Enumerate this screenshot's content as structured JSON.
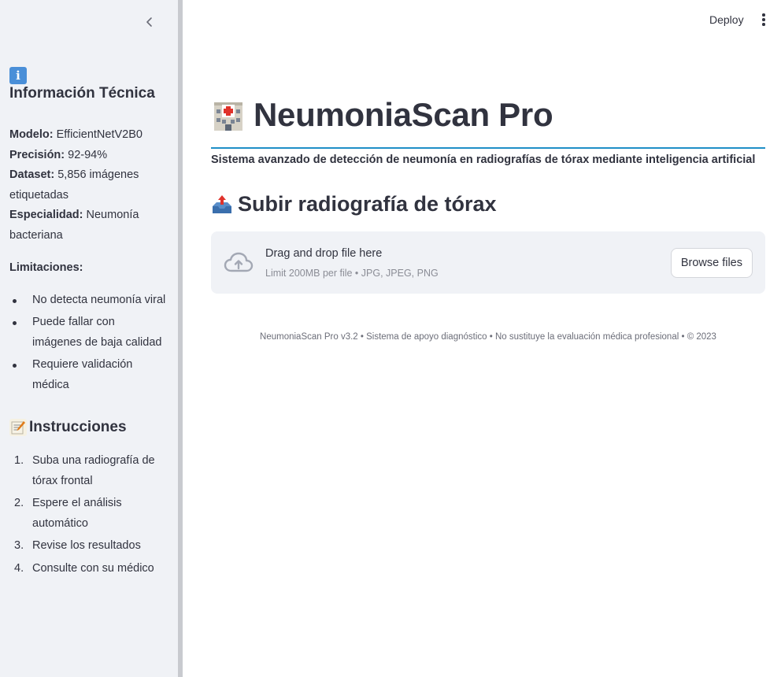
{
  "sidebar": {
    "collapse_icon": "chevron-left-icon",
    "info_heading": "Información Técnica",
    "info_icon": "info-icon",
    "specs": [
      {
        "label": "Modelo:",
        "value": " EfficientNetV2B0"
      },
      {
        "label": "Precisión:",
        "value": " 92-94%"
      },
      {
        "label": "Dataset:",
        "value": " 5,856 imágenes etiquetadas"
      },
      {
        "label": "Especialidad:",
        "value": " Neumonía bacteriana"
      }
    ],
    "limitations_label": "Limitaciones:",
    "limitations": [
      "No detecta neumonía viral",
      "Puede fallar con imágenes de baja calidad",
      "Requiere validación médica"
    ],
    "instructions_heading": "Instrucciones",
    "instructions_icon": "memo-icon",
    "instructions": [
      {
        "num": "1.",
        "text": "Suba una radiografía de tórax frontal"
      },
      {
        "num": "2.",
        "text": "Espere el análisis automático"
      },
      {
        "num": "3.",
        "text": "Revise los resultados"
      },
      {
        "num": "4.",
        "text": "Consulte con su médico"
      }
    ]
  },
  "header": {
    "deploy_label": "Deploy",
    "menu_icon": "kebab-menu-icon"
  },
  "main": {
    "title": "NeumoniaScan Pro",
    "title_icon": "hospital-icon",
    "subtitle": "Sistema avanzado de detección de neumonía en radiografías de tórax mediante inteligencia artificial",
    "upload_heading": "Subir radiografía de tórax",
    "upload_icon": "inbox-tray-icon",
    "uploader": {
      "icon": "cloud-upload-icon",
      "main_text": "Drag and drop file here",
      "sub_text": "Limit 200MB per file • JPG, JPEG, PNG",
      "browse_label": "Browse files"
    },
    "footer": "NeumoniaScan Pro v3.2 • Sistema de apoyo diagnóstico • No sustituye la evaluación médica profesional • © 2023"
  },
  "colors": {
    "accent_rule": "#1f8fc7",
    "sidebar_bg": "#f0f2f6",
    "text": "#31333f"
  }
}
